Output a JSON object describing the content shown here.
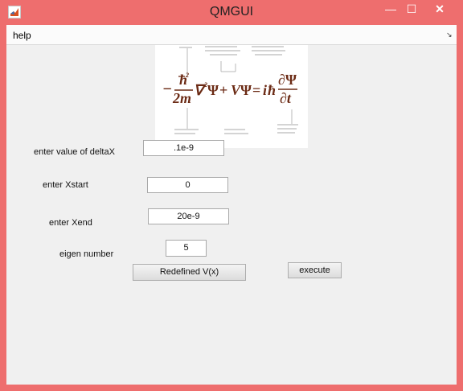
{
  "window": {
    "title": "QMGUI",
    "minimize_glyph": "—",
    "maximize_glyph": "☐",
    "close_glyph": "✕"
  },
  "menu": {
    "help_label": "help",
    "dock_glyph": "↘"
  },
  "equation_image": {
    "icon": "schrodinger-equation-image",
    "text_color": "#6b2a14"
  },
  "form": {
    "deltax_label": "enter value of deltaX",
    "deltax_value": ".1e-9",
    "xstart_label": "enter Xstart",
    "xstart_value": "0",
    "xend_label": "enter Xend",
    "xend_value": "20e-9",
    "eigen_label": "eigen number",
    "eigen_value": "5"
  },
  "buttons": {
    "redefine_label": "Redefined V(x)",
    "execute_label": "execute"
  }
}
